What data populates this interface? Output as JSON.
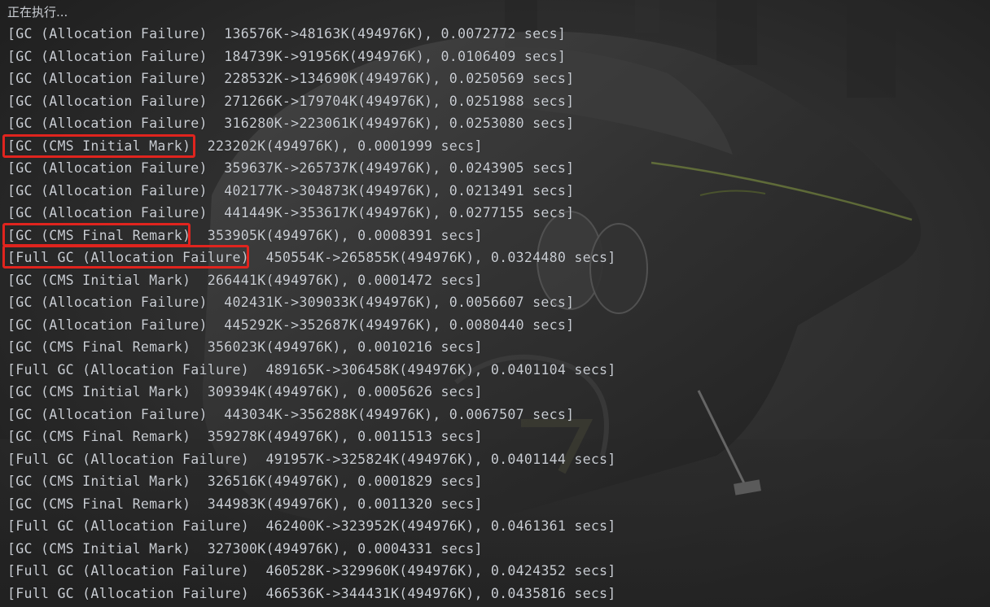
{
  "console": {
    "status": "正在执行...",
    "lines": [
      "[GC (Allocation Failure)  136576K->48163K(494976K), 0.0072772 secs]",
      "[GC (Allocation Failure)  184739K->91956K(494976K), 0.0106409 secs]",
      "[GC (Allocation Failure)  228532K->134690K(494976K), 0.0250569 secs]",
      "[GC (Allocation Failure)  271266K->179704K(494976K), 0.0251988 secs]",
      "[GC (Allocation Failure)  316280K->223061K(494976K), 0.0253080 secs]",
      "[GC (CMS Initial Mark)  223202K(494976K), 0.0001999 secs]",
      "[GC (Allocation Failure)  359637K->265737K(494976K), 0.0243905 secs]",
      "[GC (Allocation Failure)  402177K->304873K(494976K), 0.0213491 secs]",
      "[GC (Allocation Failure)  441449K->353617K(494976K), 0.0277155 secs]",
      "[GC (CMS Final Remark)  353905K(494976K), 0.0008391 secs]",
      "[Full GC (Allocation Failure)  450554K->265855K(494976K), 0.0324480 secs]",
      "[GC (CMS Initial Mark)  266441K(494976K), 0.0001472 secs]",
      "[GC (Allocation Failure)  402431K->309033K(494976K), 0.0056607 secs]",
      "[GC (Allocation Failure)  445292K->352687K(494976K), 0.0080440 secs]",
      "[GC (CMS Final Remark)  356023K(494976K), 0.0010216 secs]",
      "[Full GC (Allocation Failure)  489165K->306458K(494976K), 0.0401104 secs]",
      "[GC (CMS Initial Mark)  309394K(494976K), 0.0005626 secs]",
      "[GC (Allocation Failure)  443034K->356288K(494976K), 0.0067507 secs]",
      "[GC (CMS Final Remark)  359278K(494976K), 0.0011513 secs]",
      "[Full GC (Allocation Failure)  491957K->325824K(494976K), 0.0401144 secs]",
      "[GC (CMS Initial Mark)  326516K(494976K), 0.0001829 secs]",
      "[GC (CMS Final Remark)  344983K(494976K), 0.0011320 secs]",
      "[Full GC (Allocation Failure)  462400K->323952K(494976K), 0.0461361 secs]",
      "[GC (CMS Initial Mark)  327300K(494976K), 0.0004331 secs]",
      "[Full GC (Allocation Failure)  460528K->329960K(494976K), 0.0424352 secs]",
      "[Full GC (Allocation Failure)  466536K->344431K(494976K), 0.0435816 secs]"
    ]
  },
  "colors": {
    "background": "#2b2b2b",
    "text": "#c9cdd3",
    "annotation": "#e0241e"
  }
}
